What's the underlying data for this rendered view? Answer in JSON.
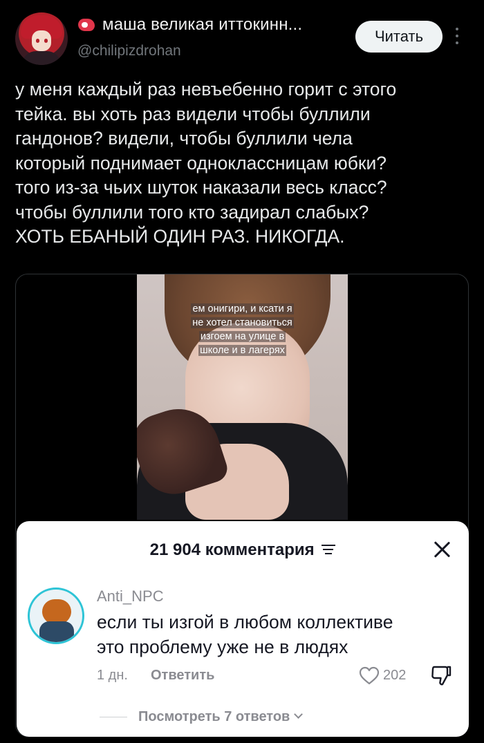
{
  "author": {
    "display_name": "маша великая иттокинн...",
    "handle": "@chilipizdrohan",
    "follow_label": "Читать"
  },
  "tweet": {
    "text": "у меня каждый раз невъебенно горит с этого\nтейка. вы хоть раз видели чтобы буллили\nгандонов? видели, чтобы буллили чела\nкоторый поднимает одноклассницам юбки?\nтого из-за чьих шуток наказали весь класс?\nчтобы буллили того кто задирал слабых?\nХОТЬ ЕБАНЫЙ ОДИН РАЗ. НИКОГДА."
  },
  "video": {
    "caption_lines": [
      "ем онигири, и ксати я",
      "не хотел становиться",
      "изгоем на улице в",
      "школе и в лагерях"
    ]
  },
  "comments_sheet": {
    "title": "21 904 комментария",
    "comment": {
      "username": "Anti_NPC",
      "text": "если ты изгой в любом коллективе\nэто проблему уже не в людях",
      "time": "1 дн.",
      "reply_label": "Ответить",
      "likes": "202"
    },
    "view_replies": "Посмотреть 7 ответов"
  }
}
